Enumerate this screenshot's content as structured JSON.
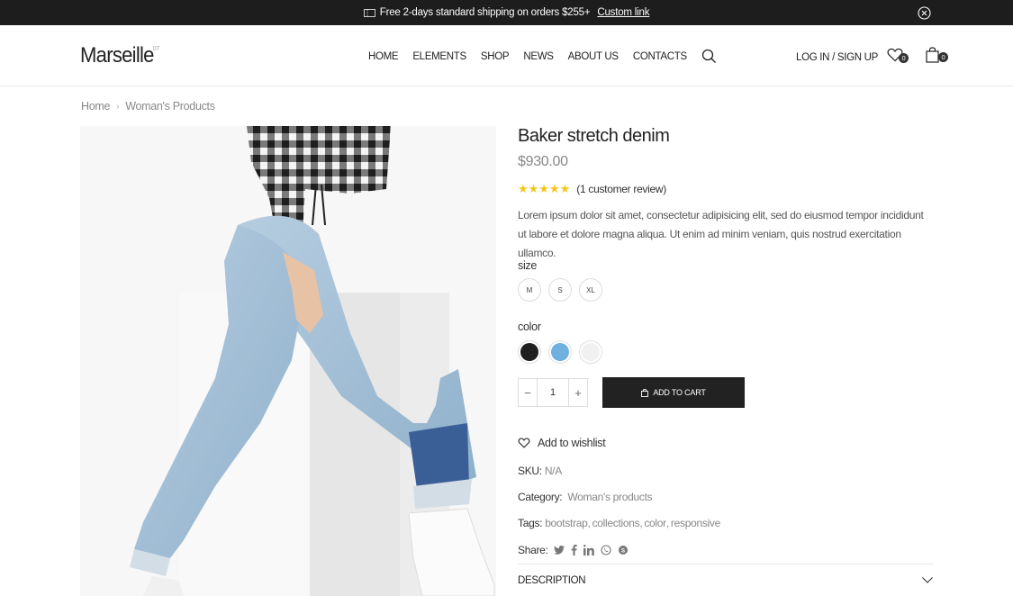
{
  "topbar": {
    "promo_text": "Free 2-days standard shipping on orders $255+",
    "promo_link": "Custom link"
  },
  "header": {
    "logo": "Marseille",
    "logo_sup": "07",
    "nav": [
      "HOME",
      "ELEMENTS",
      "SHOP",
      "NEWS",
      "ABOUT US",
      "CONTACTS"
    ],
    "login": "LOG IN / SIGN UP",
    "wishlist_count": "0",
    "cart_count": "0"
  },
  "breadcrumb": [
    "Home",
    "Woman's Products"
  ],
  "product": {
    "title": "Baker stretch denim",
    "price": "$930.00",
    "rating": 5,
    "stars": "★★★★★",
    "review_text": "(1 customer review)",
    "description": "Lorem ipsum dolor sit amet, consectetur adipisicing elit, sed do eiusmod tempor incididunt ut labore et dolore magna aliqua. Ut enim ad minim veniam, quis nostrud exercitation ullamco.",
    "size_label": "size",
    "sizes": [
      "M",
      "S",
      "XL"
    ],
    "color_label": "color",
    "colors": [
      "#1f1f1f",
      "#6fb0df",
      "#f1f1f1"
    ],
    "quantity": "1",
    "add_to_cart": "ADD TO CART",
    "wishlist": "Add to wishlist",
    "sku_label": "SKU:",
    "sku": "N/A",
    "category_label": "Category:",
    "category": "Woman's products",
    "tags_label": "Tags:",
    "tags": [
      "bootstrap",
      "collections",
      "color",
      "responsive"
    ],
    "share_label": "Share:",
    "share_icons": [
      "twitter-icon",
      "facebook-icon",
      "linkedin-icon",
      "whatsapp-icon",
      "skype-icon"
    ],
    "description_tab": "DESCRIPTION"
  }
}
